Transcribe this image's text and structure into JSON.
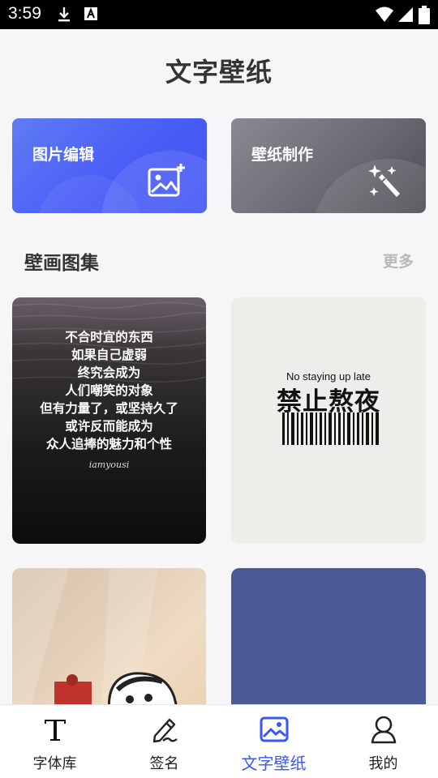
{
  "status_bar": {
    "time": "3:59"
  },
  "header": {
    "title": "文字壁纸"
  },
  "cards": [
    {
      "label": "图片编辑",
      "icon": "image-edit-icon"
    },
    {
      "label": "壁纸制作",
      "icon": "magic-wand-icon"
    }
  ],
  "section": {
    "title": "壁画图集",
    "more": "更多"
  },
  "tiles": [
    {
      "lines": [
        "不合时宜的东西",
        "如果自己虚弱",
        "终究会成为",
        "人们嘲笑的对象",
        "但有力量了，或坚持久了",
        "或许反而能成为",
        "众人追捧的魅力和个性"
      ],
      "signature": "iamyousi"
    },
    {
      "english": "No staying up late",
      "chinese": "禁止熬夜"
    }
  ],
  "tabbar": {
    "items": [
      {
        "label": "字体库",
        "icon": "font-t-icon",
        "active": false
      },
      {
        "label": "签名",
        "icon": "pen-icon",
        "active": false
      },
      {
        "label": "文字壁纸",
        "icon": "wallpaper-icon",
        "active": true
      },
      {
        "label": "我的",
        "icon": "person-icon",
        "active": false
      }
    ]
  },
  "colors": {
    "accent": "#3a57f0",
    "card_edit": "#4a5df6",
    "card_make": "#6c6a72"
  }
}
